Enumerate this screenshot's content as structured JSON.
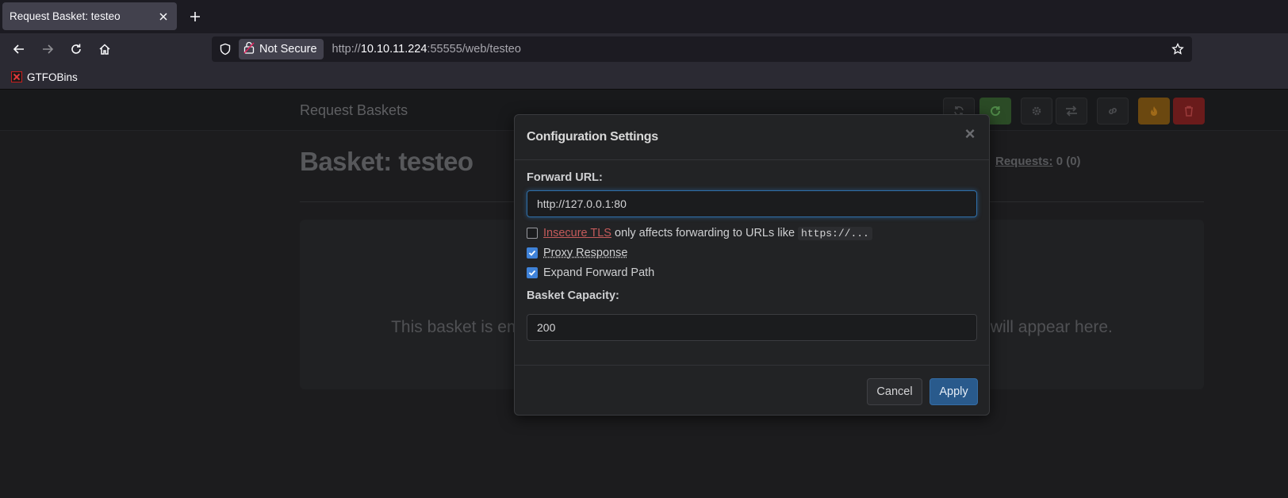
{
  "browser": {
    "tab_title": "Request Basket: testeo",
    "security_label": "Not Secure",
    "url_scheme": "http://",
    "url_host": "10.10.11.224",
    "url_rest": ":55555/web/testeo",
    "bookmark_label": "GTFOBins"
  },
  "app": {
    "brand": "Request Baskets",
    "basket_title": "Basket: testeo",
    "requests_label": "Requests:",
    "requests_count": "0 (0)",
    "empty_message": "This basket is empty, send requests to http://10.10.11.224:55555/testeo and they will appear here."
  },
  "modal": {
    "title": "Configuration Settings",
    "close": "×",
    "forward_url_label": "Forward URL:",
    "forward_url_value": "http://127.0.0.1:80",
    "insecure_tls_link": "Insecure TLS",
    "insecure_tls_text": " only affects forwarding to URLs like ",
    "insecure_tls_code": "https://...",
    "insecure_tls_checked": false,
    "proxy_response_label": "Proxy Response",
    "proxy_response_checked": true,
    "expand_path_label": "Expand Forward Path",
    "expand_path_checked": true,
    "capacity_label": "Basket Capacity:",
    "capacity_value": "200",
    "cancel_label": "Cancel",
    "apply_label": "Apply"
  },
  "colors": {
    "accent": "#295a8c",
    "checkbox_on": "#3f82d8",
    "insecure_link": "#c45a5a"
  }
}
